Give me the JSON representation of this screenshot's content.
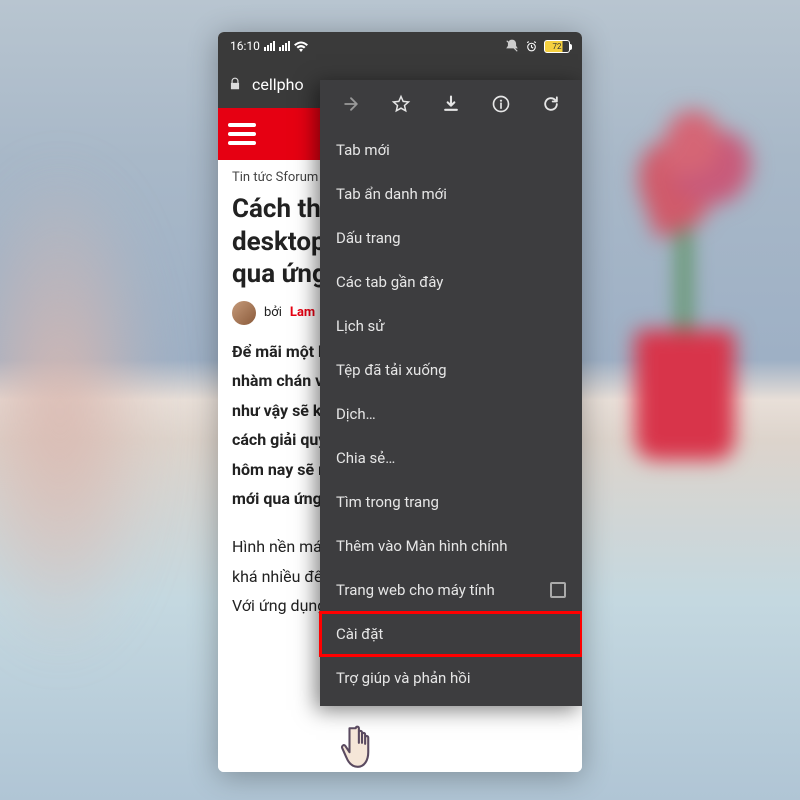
{
  "statusbar": {
    "time": "16:10",
    "battery": "72"
  },
  "addressbar": {
    "url_short": "cellpho"
  },
  "page": {
    "breadcrumb": "Tin tức Sforum",
    "headline": "Cách thay đổi hình nền desktop tự động mỗi ngày qua ứng dụng Wallpaper",
    "by_prefix": "bởi",
    "author": "Lam",
    "paragraph1": "Để mãi một hình nền khiến chúng ta cảm thấy nhàm chán và muốn đổi hình nền mới, nhưng như vậy sẽ khá mất thời gian. Bạn đang tìm cách giải quyết khác? Nếu vậy, bài viết ngày hôm nay sẽ mách bạn cách thay đổi hình nền mới qua ứng dụng Wallpaper.",
    "paragraph2": "Hình nền máy tính được cho là có ảnh hưởng khá nhiều đến trải nghiệm sử dụng máy tính. Với ứng dụng Wallpaper, hình nền"
  },
  "menu": {
    "new_tab": "Tab mới",
    "incognito": "Tab ẩn danh mới",
    "bookmarks": "Dấu trang",
    "recent_tabs": "Các tab gần đây",
    "history": "Lịch sử",
    "downloads": "Tệp đã tải xuống",
    "translate": "Dịch…",
    "share": "Chia sẻ…",
    "find": "Tìm trong trang",
    "add_home": "Thêm vào Màn hình chính",
    "desktop_site": "Trang web cho máy tính",
    "settings": "Cài đặt",
    "help": "Trợ giúp và phản hồi"
  }
}
